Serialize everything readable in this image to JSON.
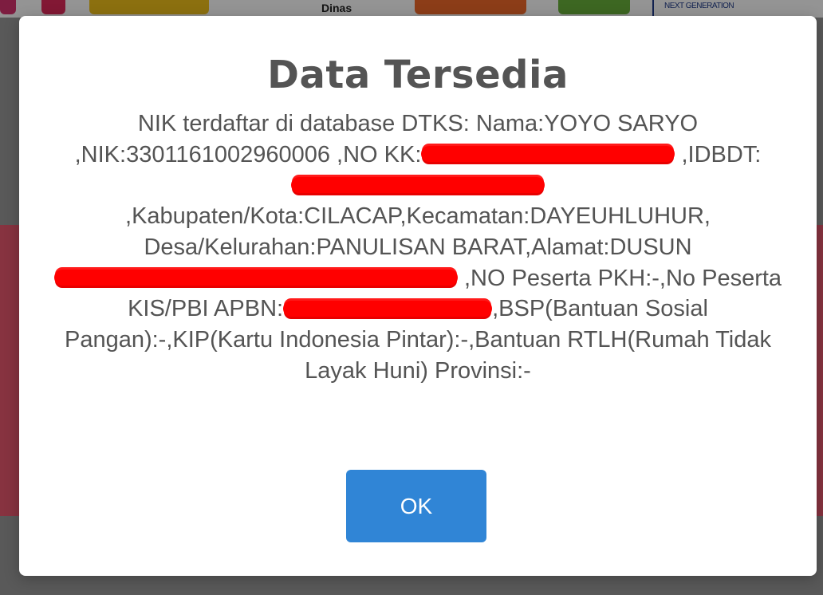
{
  "background": {
    "brand_text": "Dinas",
    "tagline": "NEXT GENERATION"
  },
  "dialog": {
    "title": "Data Tersedia",
    "segments": {
      "s1": "NIK terdaftar di database DTKS: Nama:YOYO SARYO ,NIK:3301161002960006 ,NO KK:",
      "s2": " ,IDBDT:",
      "s3": " ,Kabupaten/Kota:CILACAP,Kecamatan:DAYEUHLUHUR, Desa/Kelurahan:PANULISAN BARAT,Alamat:DUSUN ",
      "s4": " ,NO Peserta PKH:-,No Peserta KIS/PBI APBN:",
      "s5": ",BSP(Bantuan Sosial Pangan):-,KIP(Kartu Indonesia Pintar):-,Bantuan RTLH(Rumah Tidak Layak Huni) Provinsi:-"
    },
    "ok_label": "OK"
  },
  "colors": {
    "title": "#545454",
    "body_text": "#545454",
    "ok_button": "#3085d6",
    "redaction": "#ff0000",
    "background_band": "#e8586f"
  }
}
